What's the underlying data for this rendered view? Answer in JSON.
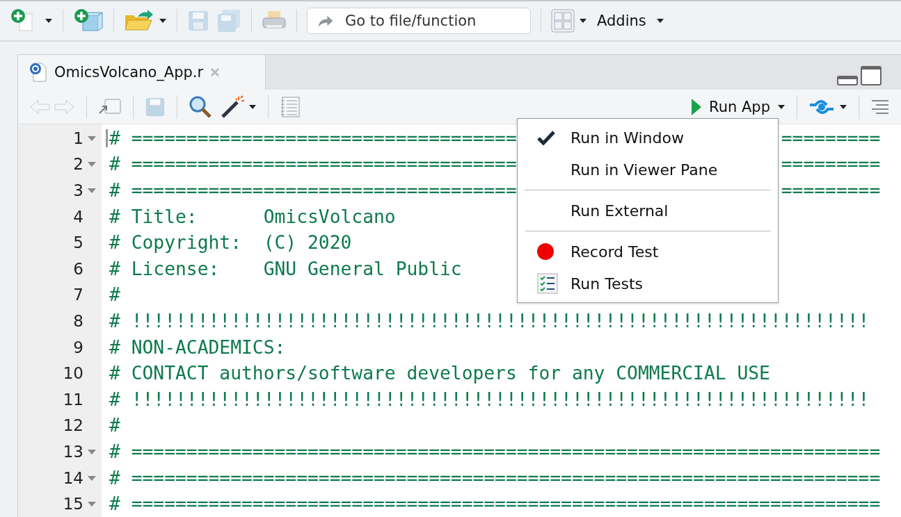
{
  "main_toolbar": {
    "buttons": [
      {
        "kind": "new-file",
        "dropdown": true,
        "disabled": false
      },
      {
        "kind": "new-project",
        "dropdown": false,
        "disabled": false
      },
      {
        "kind": "open",
        "dropdown": true,
        "disabled": false
      },
      {
        "kind": "save",
        "dropdown": false,
        "disabled": true
      },
      {
        "kind": "save-all",
        "dropdown": false,
        "disabled": true
      },
      {
        "kind": "print",
        "dropdown": false,
        "disabled": false
      }
    ],
    "goto": {
      "placeholder": "Go to file/function"
    },
    "addins": "Addins"
  },
  "editor_tab": {
    "title": "OmicsVolcano_App.r",
    "selected": true
  },
  "editor_toolbar": {
    "run_button": "Run App"
  },
  "code_lines": [
    {
      "number": "1",
      "fold": true,
      "text": "# ===================================",
      "text_right": "========="
    },
    {
      "number": "2",
      "fold": true,
      "text": "# ===================================",
      "text_right": "========="
    },
    {
      "number": "3",
      "fold": true,
      "text": "# ===================================",
      "text_right": "========="
    },
    {
      "number": "4",
      "fold": false,
      "text": "# Title:      OmicsVolcano"
    },
    {
      "number": "5",
      "fold": false,
      "text": "# Copyright:  (C) 2020"
    },
    {
      "number": "6",
      "fold": false,
      "text": "# License:    GNU General Public"
    },
    {
      "number": "7",
      "fold": false,
      "text": "#"
    },
    {
      "number": "8",
      "fold": false,
      "text": "# !!!!!!!!!!!!!!!!!!!!!!!!!!!!!!!!!!!!!!!!!!!!!!!!!!!!!!!!!!!!!!!!!!!"
    },
    {
      "number": "9",
      "fold": false,
      "text": "# NON-ACADEMICS:"
    },
    {
      "number": "10",
      "fold": false,
      "text": "# CONTACT authors/software developers for any COMMERCIAL USE"
    },
    {
      "number": "11",
      "fold": false,
      "text": "# !!!!!!!!!!!!!!!!!!!!!!!!!!!!!!!!!!!!!!!!!!!!!!!!!!!!!!!!!!!!!!!!!!!"
    },
    {
      "number": "12",
      "fold": false,
      "text": "#"
    },
    {
      "number": "13",
      "fold": true,
      "text": "# ===================================================================="
    },
    {
      "number": "14",
      "fold": true,
      "text": "# ===================================================================="
    },
    {
      "number": "15",
      "fold": true,
      "text": "# ===================================================================="
    }
  ],
  "run_menu": {
    "groups": [
      {
        "items": [
          {
            "label": "Run in Window",
            "kind": "option",
            "checked": true
          },
          {
            "label": "Run in Viewer Pane",
            "kind": "option",
            "checked": false
          }
        ]
      },
      {
        "items": [
          {
            "label": "Run External",
            "kind": "option",
            "checked": false
          }
        ]
      },
      {
        "items": [
          {
            "label": "Record Test",
            "kind": "record"
          },
          {
            "label": "Run Tests",
            "kind": "tests"
          }
        ]
      }
    ]
  }
}
